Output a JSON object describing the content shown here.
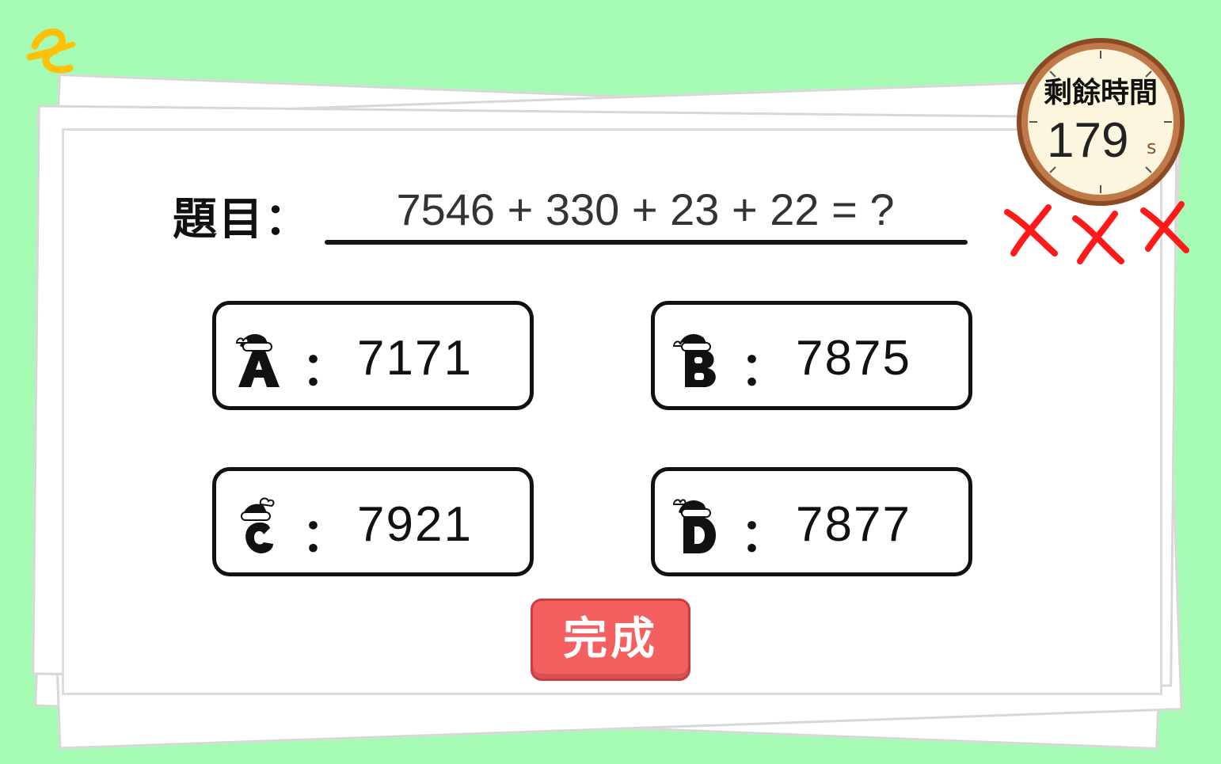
{
  "question": {
    "label": "題目：",
    "expression": "7546 + 330 + 23 + 22 = ?"
  },
  "options": [
    {
      "letter": "A",
      "sep": "：",
      "value": "7171"
    },
    {
      "letter": "B",
      "sep": "：",
      "value": "7875"
    },
    {
      "letter": "C",
      "sep": "：",
      "value": "7921"
    },
    {
      "letter": "D",
      "sep": "：",
      "value": "7877"
    }
  ],
  "submit": {
    "label": "完成"
  },
  "timer": {
    "title": "剩餘時間",
    "seconds": "179",
    "unit": "s"
  },
  "lives": {
    "icon": "x-mark-icon",
    "count": 3,
    "color": "#ff1a1a"
  },
  "colors": {
    "background": "#a5fbb3",
    "button": "#f45f5f",
    "logo": "#ffc107",
    "clock_rim": "#8b4a24"
  }
}
